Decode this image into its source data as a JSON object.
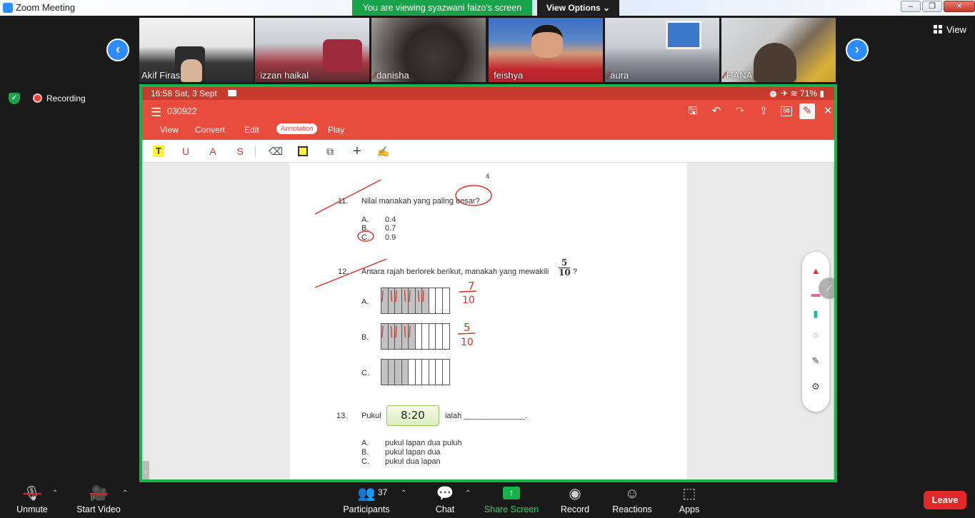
{
  "window": {
    "title": "Zoom Meeting",
    "minimize": "–",
    "maximize": "❐",
    "close": "✕"
  },
  "banner": {
    "viewing": "You are viewing syazwani faizo's screen",
    "view_options": "View Options ⌄"
  },
  "gallery": {
    "prev": "‹",
    "next": "›",
    "tiles": [
      {
        "name": "Akif Firas",
        "muted": false,
        "mute_icon": ""
      },
      {
        "name": "izzan haikal",
        "muted": true,
        "mute_icon": "⁄"
      },
      {
        "name": "danisha",
        "muted": true,
        "mute_icon": "⁄"
      },
      {
        "name": "feishya",
        "muted": true,
        "mute_icon": "⁄"
      },
      {
        "name": "aura",
        "muted": true,
        "mute_icon": "⁄"
      },
      {
        "name": "HANA",
        "muted": true,
        "mute_icon": "⁄"
      }
    ],
    "view_label": "View"
  },
  "recording": {
    "label": "Recording",
    "shield": "✓"
  },
  "phone": {
    "time": "16:58  Sat, 3 Sept",
    "status_right": "⏰ ✈ ≋ 71% ▮",
    "doc_name": "030922",
    "menu_icon": "☰",
    "tool_icons": {
      "save": "🖫",
      "undo": "↶",
      "redo": "↷",
      "share": "⇪",
      "badge": "50",
      "pen": "✎",
      "close": "✕"
    },
    "tabs": [
      "View",
      "Convert",
      "Edit",
      "Annotation",
      "Play"
    ],
    "annot_tools": {
      "highlight": "T",
      "underline": "U",
      "font_color": "A",
      "strike": "S",
      "eraser": "⌫",
      "shape": "⧉",
      "add": "+",
      "sign": "✍"
    }
  },
  "document": {
    "page_number": "4",
    "q11": {
      "number": "11.",
      "text": "Nilai manakah yang paling besar?",
      "options": [
        {
          "letter": "A.",
          "value": "0.4"
        },
        {
          "letter": "B.",
          "value": "0.7"
        },
        {
          "letter": "C.",
          "value": "0.9"
        }
      ]
    },
    "q12": {
      "number": "12.",
      "text": "Antara rajah berlorek berikut, manakah yang mewakili",
      "frac_num": "5",
      "frac_den": "10",
      "suffix": "?",
      "options": [
        {
          "letter": "A.",
          "shaded": 7,
          "total": 10,
          "ink_num": "7",
          "ink_den": "10"
        },
        {
          "letter": "B.",
          "shaded": 5,
          "total": 10,
          "ink_num": "5",
          "ink_den": "10"
        },
        {
          "letter": "C.",
          "shaded": 4,
          "total": 10,
          "ink_num": "",
          "ink_den": ""
        }
      ]
    },
    "q13": {
      "number": "13.",
      "prefix": "Pukul",
      "clock": "8:20",
      "suffix": "ialah ______________.",
      "options": [
        {
          "letter": "A.",
          "text": "pukul lapan dua puluh"
        },
        {
          "letter": "B.",
          "text": "pukul lapan dua"
        },
        {
          "letter": "C.",
          "text": "pukul dua lapan"
        }
      ]
    }
  },
  "pen_panel": {
    "pen": "▲",
    "marker": "▬",
    "highlighter": "▮",
    "lasso": "◌",
    "edit": "✎",
    "settings": "⚙",
    "handle": "⟋"
  },
  "toolbar": {
    "unmute": "Unmute",
    "start_video": "Start Video",
    "participants": "Participants",
    "participants_count": "37",
    "chat": "Chat",
    "share_screen": "Share Screen",
    "record": "Record",
    "reactions": "Reactions",
    "apps": "Apps",
    "leave": "Leave",
    "icons": {
      "mic": "🎙",
      "video": "🎥",
      "participants": "👥",
      "chat": "💬",
      "share": "↑",
      "record": "◉",
      "reactions": "☺",
      "apps": "⬚",
      "caret": "⌃"
    }
  },
  "colors": {
    "zoom_blue": "#2d8cff",
    "share_green": "#17b34a",
    "wps_red": "#e74c3c",
    "ink_red": "#d9312b",
    "leave_red": "#e02828"
  }
}
